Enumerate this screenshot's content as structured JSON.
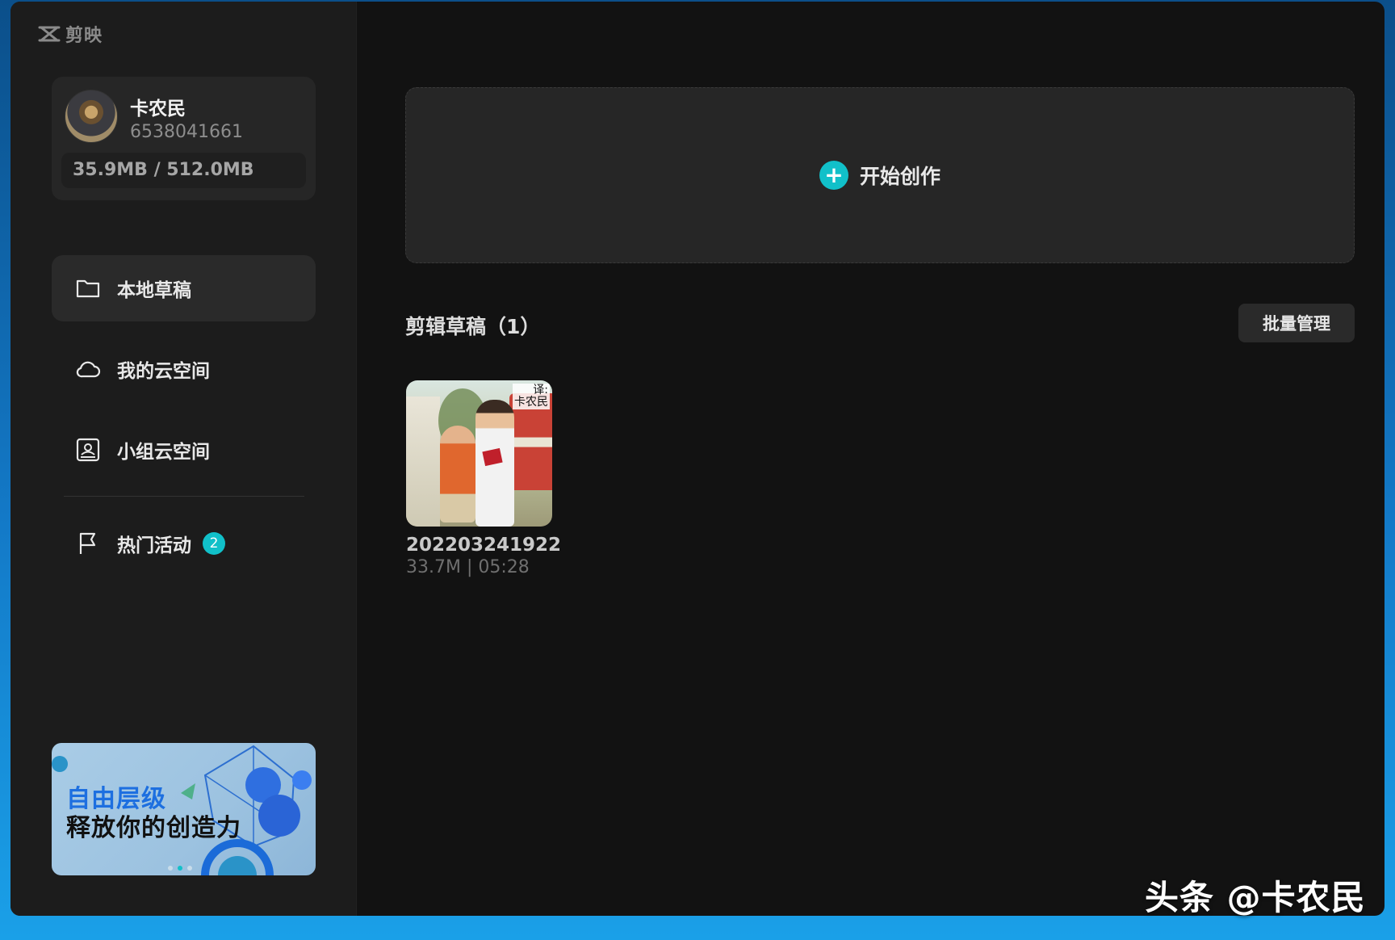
{
  "app": {
    "name": "剪映"
  },
  "user": {
    "name": "卡农民",
    "id": "6538041661",
    "storage": "35.9MB / 512.0MB"
  },
  "sidebar": {
    "items": [
      {
        "label": "本地草稿",
        "icon": "folder-icon",
        "active": true
      },
      {
        "label": "我的云空间",
        "icon": "cloud-icon",
        "active": false
      },
      {
        "label": "小组云空间",
        "icon": "group-space-icon",
        "active": false
      },
      {
        "label": "热门活动",
        "icon": "flag-icon",
        "active": false,
        "badge": "2"
      }
    ]
  },
  "banner": {
    "line1": "自由层级",
    "line2": "释放你的创造力"
  },
  "titlebar": {
    "icons": [
      "help-icon",
      "feedback-icon",
      "settings-icon",
      "minimize-icon",
      "close-icon"
    ]
  },
  "main": {
    "create_label": "开始创作",
    "section_title": "剪辑草稿（1）",
    "batch_label": "批量管理",
    "drafts": [
      {
        "name": "202203241922",
        "meta": "33.7M | 05:28",
        "thumb_caption_l1": "译:",
        "thumb_caption_l2": "卡农民"
      }
    ]
  },
  "watermark": "头条 @卡农民",
  "colors": {
    "accent": "#11c0c9",
    "window_bg": "#121212",
    "sidebar_bg": "#1c1c1c",
    "card_bg": "#262626"
  }
}
